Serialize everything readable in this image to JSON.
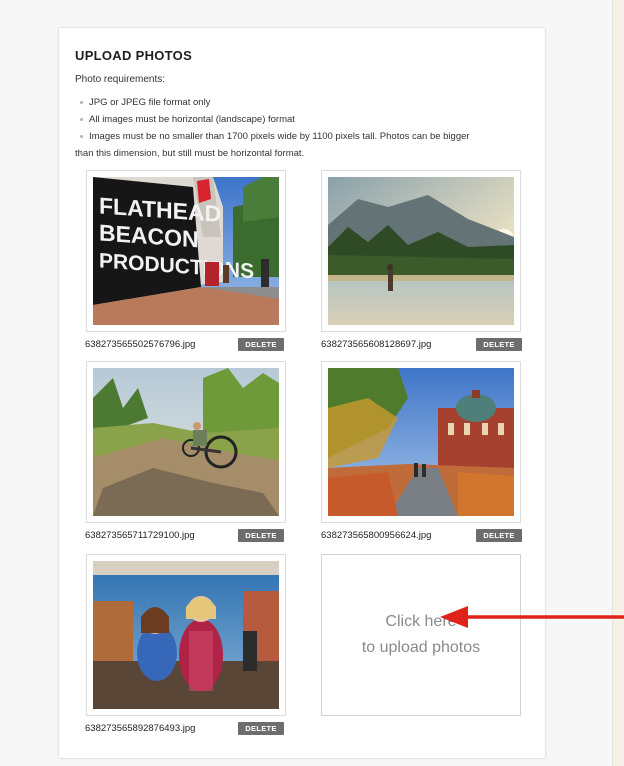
{
  "section": {
    "title": "UPLOAD PHOTOS",
    "requirements_label": "Photo requirements:",
    "requirements": [
      "JPG or JPEG file format only",
      "All images must be horizontal (landscape) format",
      "Images must be no smaller than 1700 pixels wide by 1100 pixels tall. Photos can be bigger",
      "than this dimension, but still must be horizontal format."
    ]
  },
  "photos": [
    {
      "filename": "638273565502576796.jpg",
      "delete_label": "DELETE",
      "sign_text": [
        "FLATHEAD",
        "BEACON",
        "PRODUCTIONS"
      ]
    },
    {
      "filename": "638273565608128697.jpg",
      "delete_label": "DELETE"
    },
    {
      "filename": "638273565711729100.jpg",
      "delete_label": "DELETE"
    },
    {
      "filename": "638273565800956624.jpg",
      "delete_label": "DELETE"
    },
    {
      "filename": "638273565892876493.jpg",
      "delete_label": "DELETE"
    }
  ],
  "upload": {
    "line1": "Click here",
    "line2": "to upload photos"
  },
  "colors": {
    "delete_button": "#6d6d6d",
    "annotation_arrow": "#e0221b",
    "upload_text": "#8a8a8a"
  }
}
